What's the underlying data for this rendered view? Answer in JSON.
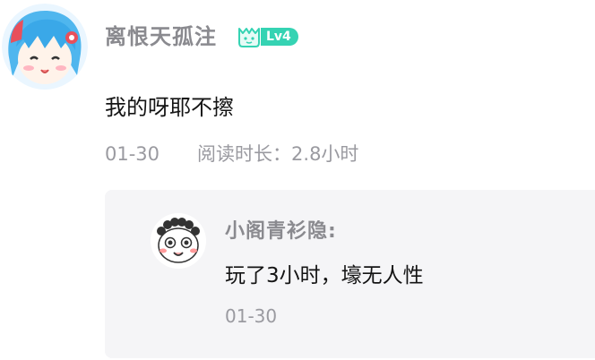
{
  "comment": {
    "username": "离恨天孤注",
    "level": "Lv4",
    "text": "我的呀耶不擦",
    "date": "01-30",
    "read_duration": "阅读时长：2.8小时"
  },
  "reply": {
    "username": "小阁青衫隐",
    "separator": ":",
    "text": "玩了3小时，壕无人性",
    "date": "01-30"
  },
  "colors": {
    "level_badge": "#35d3b3",
    "username": "#8a8a8f",
    "meta": "#9a9aa0",
    "reply_bg": "#f5f5f7"
  },
  "icons": {
    "avatar": "anime-girl-avatar",
    "level": "level-badge-icon",
    "reply_avatar": "cartoon-face-avatar"
  }
}
